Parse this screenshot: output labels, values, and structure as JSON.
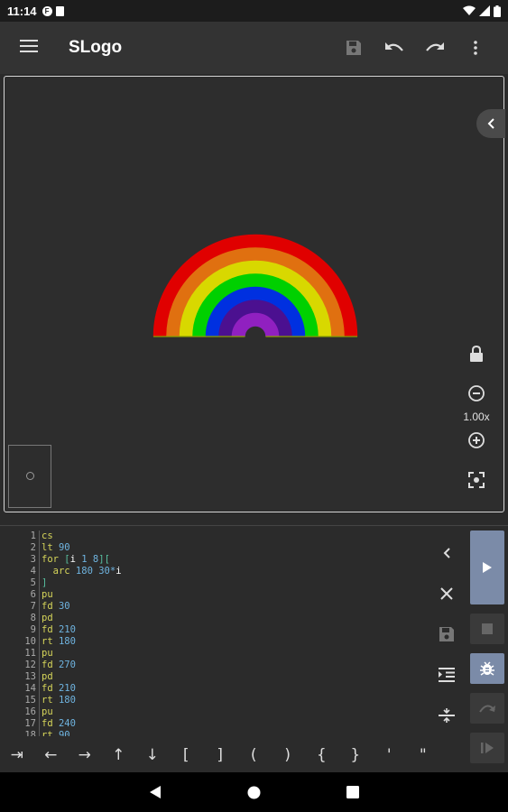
{
  "status_bar": {
    "time": "11:14",
    "notif_icon": "F"
  },
  "app_bar": {
    "title": "SLogo"
  },
  "canvas": {
    "zoom": "1.00x",
    "rainbow_colors": [
      "#e00000",
      "#e07010",
      "#d8d800",
      "#00d000",
      "#0030e0",
      "#4b1090",
      "#9020c0"
    ]
  },
  "editor": {
    "line_numbers": [
      "1",
      "2",
      "3",
      "4",
      "5",
      "6",
      "7",
      "8",
      "9",
      "10",
      "11",
      "12",
      "13",
      "14",
      "15",
      "16",
      "17",
      "18"
    ],
    "lines": [
      [
        {
          "t": "cs",
          "c": "kw"
        }
      ],
      [
        {
          "t": "lt",
          "c": "kw"
        },
        {
          "t": " 90",
          "c": "num"
        }
      ],
      [
        {
          "t": "for",
          "c": "kw"
        },
        {
          "t": " [",
          "c": "br"
        },
        {
          "t": "i",
          "c": "var"
        },
        {
          "t": " 1 8",
          "c": "num"
        },
        {
          "t": "][",
          "c": "br"
        }
      ],
      [
        {
          "t": "  arc",
          "c": "kw"
        },
        {
          "t": " 180 30*",
          "c": "num"
        },
        {
          "t": "i",
          "c": "var"
        }
      ],
      [
        {
          "t": "]",
          "c": "br"
        }
      ],
      [
        {
          "t": "pu",
          "c": "kw"
        }
      ],
      [
        {
          "t": "fd",
          "c": "kw"
        },
        {
          "t": " 30",
          "c": "num"
        }
      ],
      [
        {
          "t": "pd",
          "c": "kw"
        }
      ],
      [
        {
          "t": "fd",
          "c": "kw"
        },
        {
          "t": " 210",
          "c": "num"
        }
      ],
      [
        {
          "t": "rt",
          "c": "kw"
        },
        {
          "t": " 180",
          "c": "num"
        }
      ],
      [
        {
          "t": "pu",
          "c": "kw"
        }
      ],
      [
        {
          "t": "fd",
          "c": "kw"
        },
        {
          "t": " 270",
          "c": "num"
        }
      ],
      [
        {
          "t": "pd",
          "c": "kw"
        }
      ],
      [
        {
          "t": "fd",
          "c": "kw"
        },
        {
          "t": " 210",
          "c": "num"
        }
      ],
      [
        {
          "t": "rt",
          "c": "kw"
        },
        {
          "t": " 180",
          "c": "num"
        }
      ],
      [
        {
          "t": "pu",
          "c": "kw"
        }
      ],
      [
        {
          "t": "fd",
          "c": "kw"
        },
        {
          "t": " 240",
          "c": "num"
        }
      ],
      [
        {
          "t": "rt",
          "c": "kw"
        },
        {
          "t": " 90",
          "c": "num"
        }
      ]
    ]
  },
  "symbols": [
    "⇥",
    "←",
    "→",
    "↑",
    "↓",
    "[",
    "]",
    "(",
    ")",
    "{",
    "}",
    "'",
    "\""
  ]
}
